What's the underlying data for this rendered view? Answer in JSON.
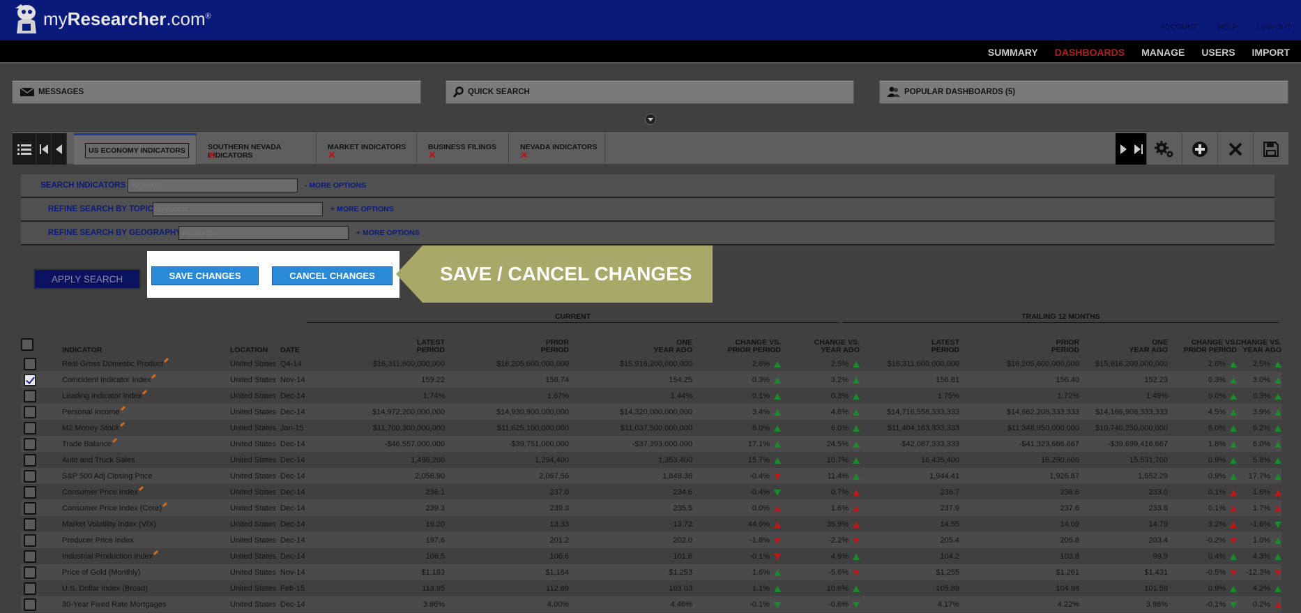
{
  "brand": {
    "prefix": "my",
    "bold": "Researcher",
    "suffix": ".com",
    "reg": "®"
  },
  "top_links": [
    "ACCOUNT",
    "HELP",
    "LOG OUT"
  ],
  "nav": {
    "items": [
      "SUMMARY",
      "DASHBOARDS",
      "MANAGE",
      "USERS",
      "IMPORT"
    ],
    "active": "DASHBOARDS"
  },
  "panels": {
    "messages": "MESSAGES",
    "quick_search": "QUICK SEARCH",
    "popular": "POPULAR DASHBOARDS (5)"
  },
  "tabs": [
    "US ECONOMY INDICATORS",
    "SOUTHERN NEVADA INDICATORS",
    "MARKET INDICATORS",
    "BUSINESS FILINGS",
    "NEVADA INDICATORS"
  ],
  "search": {
    "indicators_label": "SEARCH INDICATORS",
    "topic_label": "REFINE SEARCH BY TOPIC",
    "geo_label": "REFINE SEARCH BY GEOGRAPHY",
    "placeholder": "Keywords",
    "more_collapse": "-  MORE OPTIONS",
    "more_expand": "+  MORE OPTIONS"
  },
  "buttons": {
    "apply": "APPLY SEARCH",
    "save": "SAVE CHANGES",
    "cancel": "CANCEL CHANGES"
  },
  "callout": "SAVE / CANCEL CHANGES",
  "groups": {
    "current": "CURRENT",
    "trailing": "TRAILING 12 MONTHS"
  },
  "columns": {
    "indicator": "INDICATOR",
    "location": "LOCATION",
    "date": "DATE",
    "latest": [
      "LATEST",
      "PERIOD"
    ],
    "prior": [
      "PRIOR",
      "PERIOD"
    ],
    "one_year": [
      "ONE",
      "YEAR AGO"
    ],
    "chg_prior": [
      "CHANGE VS.",
      "PRIOR PERIOD"
    ],
    "chg_year": [
      "CHANGE VS.",
      "YEAR AGO"
    ]
  },
  "rows": [
    {
      "name": "Real Gross Domestic Product",
      "pen": true,
      "checked": false,
      "loc": "United States",
      "date": "Q4-14",
      "c": [
        "$16,311,600,000,000",
        "$16,205,600,000,000",
        "$15,916,200,000,000",
        "2.6%",
        "up-g",
        "2.5%",
        "up-g"
      ],
      "t": [
        "$16,311,600,000,000",
        "$16,205,600,000,000",
        "$15,916,200,000,000",
        "2.6%",
        "up-g",
        "2.5%",
        "up-g"
      ]
    },
    {
      "name": "Coincident Indicator Index",
      "pen": true,
      "checked": true,
      "loc": "United States",
      "date": "Nov-14",
      "c": [
        "159.22",
        "158.74",
        "154.25",
        "0.3%",
        "up-g",
        "3.2%",
        "up-g"
      ],
      "t": [
        "156.81",
        "156.40",
        "152.23",
        "0.3%",
        "up-g",
        "3.0%",
        "up-g"
      ]
    },
    {
      "name": "Leading Indicator Index",
      "pen": true,
      "checked": false,
      "loc": "United States",
      "date": "Dec-14",
      "c": [
        "1.74%",
        "1.67%",
        "1.44%",
        "0.1%",
        "up-g",
        "0.3%",
        "up-g"
      ],
      "t": [
        "1.75%",
        "1.72%",
        "1.49%",
        "0.0%",
        "up-g",
        "0.3%",
        "up-g"
      ]
    },
    {
      "name": "Personal Income",
      "pen": true,
      "checked": false,
      "loc": "United States",
      "date": "Dec-14",
      "c": [
        "$14,972,200,000,000",
        "$14,930,900,000,000",
        "$14,320,000,000,000",
        "3.4%",
        "up-g",
        "4.6%",
        "up-g"
      ],
      "t": [
        "$14,716,558,333,333",
        "$14,662,208,333,333",
        "$14,166,908,333,333",
        "4.5%",
        "up-g",
        "3.9%",
        "up-g"
      ]
    },
    {
      "name": "M2 Money Stock",
      "pen": true,
      "checked": false,
      "loc": "United States",
      "date": "Jan-15",
      "c": [
        "$11,700,300,000,000",
        "$11,625,100,000,000",
        "$11,037,500,000,000",
        "8.0%",
        "up-g",
        "6.0%",
        "up-g"
      ],
      "t": [
        "$11,404,183,333,333",
        "$11,348,950,000,000",
        "$10,740,250,000,000",
        "6.0%",
        "up-g",
        "6.2%",
        "up-g"
      ]
    },
    {
      "name": "Trade Balance",
      "pen": true,
      "checked": false,
      "loc": "United States",
      "date": "Dec-14",
      "c": [
        "-$46,557,000,000",
        "-$39,751,000,000",
        "-$37,393,000,000",
        "17.1%",
        "up-g",
        "24.5%",
        "up-g"
      ],
      "t": [
        "-$42,087,333,333",
        "-$41,323,666,667",
        "-$39,699,416,667",
        "1.8%",
        "up-g",
        "6.0%",
        "up-g"
      ]
    },
    {
      "name": "Auto and Truck Sales",
      "pen": false,
      "checked": false,
      "loc": "United States",
      "date": "Dec-14",
      "c": [
        "1,498,200",
        "1,294,400",
        "1,353,400",
        "15.7%",
        "up-g",
        "10.7%",
        "up-g"
      ],
      "t": [
        "16,435,400",
        "16,290,600",
        "15,531,700",
        "0.9%",
        "up-g",
        "5.8%",
        "up-g"
      ]
    },
    {
      "name": "S&P 500 Adj Closing Price",
      "pen": false,
      "checked": false,
      "loc": "United States",
      "date": "Dec-14",
      "c": [
        "2,058.90",
        "2,067.56",
        "1,848.36",
        "-0.4%",
        "dn-r",
        "11.4%",
        "up-g"
      ],
      "t": [
        "1,944.41",
        "1,926.87",
        "1,652.29",
        "0.9%",
        "up-g",
        "17.7%",
        "up-g"
      ]
    },
    {
      "name": "Consumer Price Index",
      "pen": true,
      "checked": false,
      "loc": "United States",
      "date": "Dec-14",
      "c": [
        "236.1",
        "237.0",
        "234.6",
        "-0.4%",
        "dn-g",
        "0.7%",
        "up-r"
      ],
      "t": [
        "236.7",
        "236.6",
        "233.0",
        "0.1%",
        "up-r",
        "1.6%",
        "up-r"
      ]
    },
    {
      "name": "Consumer Price Index (Core)",
      "pen": true,
      "checked": false,
      "loc": "United States",
      "date": "Dec-14",
      "c": [
        "239.3",
        "239.3",
        "235.5",
        "0.0%",
        "up-r",
        "1.6%",
        "up-r"
      ],
      "t": [
        "237.9",
        "237.6",
        "233.8",
        "0.1%",
        "up-r",
        "1.7%",
        "up-r"
      ]
    },
    {
      "name": "Market Volatility Index (VIX)",
      "pen": false,
      "checked": false,
      "loc": "United States",
      "date": "Dec-14",
      "c": [
        "19.20",
        "13.33",
        "13.72",
        "44.0%",
        "up-r",
        "39.9%",
        "up-r"
      ],
      "t": [
        "14.55",
        "14.09",
        "14.79",
        "3.2%",
        "up-r",
        "-1.6%",
        "dn-g"
      ]
    },
    {
      "name": "Producer Price Index",
      "pen": false,
      "checked": false,
      "loc": "United States",
      "date": "Dec-14",
      "c": [
        "197.6",
        "201.2",
        "202.0",
        "-1.8%",
        "dn-r",
        "-2.2%",
        "dn-r"
      ],
      "t": [
        "205.4",
        "205.8",
        "203.4",
        "-0.2%",
        "dn-r",
        "1.0%",
        "up-g"
      ]
    },
    {
      "name": "Industrial Production Index",
      "pen": true,
      "checked": false,
      "loc": "United States",
      "date": "Dec-14",
      "c": [
        "106.5",
        "106.6",
        "101.6",
        "-0.1%",
        "dn-r",
        "4.9%",
        "up-g"
      ],
      "t": [
        "104.2",
        "103.8",
        "99.9",
        "0.4%",
        "up-g",
        "4.3%",
        "up-g"
      ]
    },
    {
      "name": "Price of Gold (Monthly)",
      "pen": false,
      "checked": false,
      "loc": "United States",
      "date": "Nov-14",
      "c": [
        "$1,183",
        "$1,164",
        "$1,253",
        "1.6%",
        "up-g",
        "-5.6%",
        "dn-r"
      ],
      "t": [
        "$1,255",
        "$1,261",
        "$1,431",
        "-0.5%",
        "dn-r",
        "-12.3%",
        "dn-r"
      ]
    },
    {
      "name": "U.S. Dollar Index (Broad)",
      "pen": false,
      "checked": false,
      "loc": "United States",
      "date": "Feb-15",
      "c": [
        "113.95",
        "112.69",
        "103.03",
        "1.1%",
        "up-g",
        "10.6%",
        "up-g"
      ],
      "t": [
        "105.89",
        "104.98",
        "101.58",
        "0.9%",
        "up-g",
        "4.2%",
        "up-g"
      ]
    },
    {
      "name": "30-Year Fixed Rate Mortgages",
      "pen": false,
      "checked": false,
      "loc": "United States",
      "date": "Dec-14",
      "c": [
        "3.86%",
        "4.00%",
        "4.46%",
        "-0.1%",
        "dn-g",
        "-0.6%",
        "dn-g"
      ],
      "t": [
        "4.17%",
        "4.22%",
        "3.98%",
        "-0.1%",
        "dn-g",
        "0.2%",
        "up-r"
      ]
    }
  ]
}
